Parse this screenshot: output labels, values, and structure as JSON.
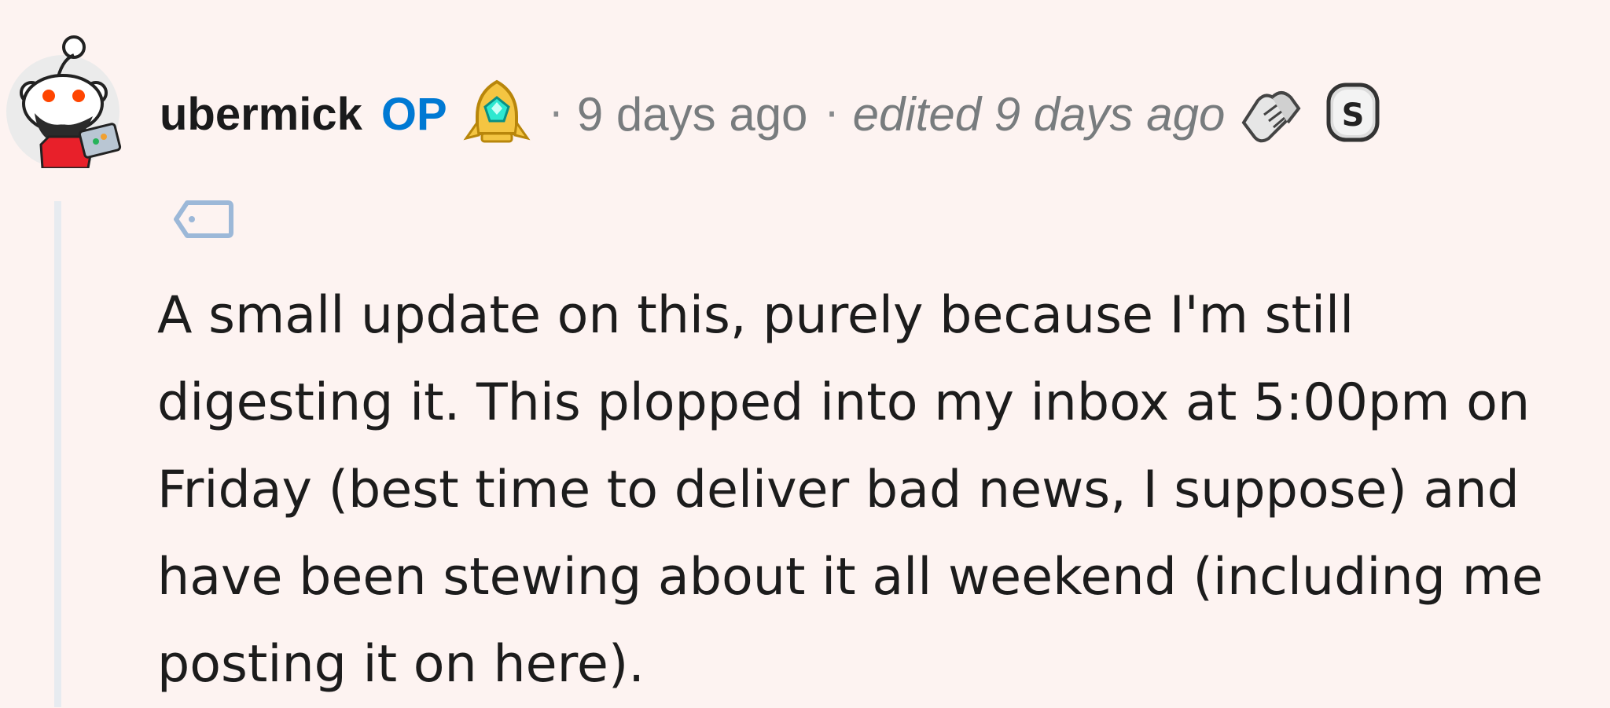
{
  "comment": {
    "author": "ubermick",
    "op_label": "OP",
    "separator": "·",
    "timestamp": "9 days ago",
    "edited": "edited 9 days ago",
    "award_icon": "gem-rocket-award-icon",
    "badges": [
      "handshake-badge-icon",
      "silver-s-badge-icon"
    ],
    "flair_icon": "tag-icon",
    "body": "A small update on this, purely because I'm still digesting it. This plopped into my inbox at 5:00pm on Friday (best time to deliver bad news, I suppose) and have been stewing about it all weekend (including me posting it on here)."
  },
  "colors": {
    "background": "#fdf3f1",
    "op": "#0079d3",
    "meta": "#787c7e",
    "thread_line": "#e7ebf0",
    "avatar_shirt": "#e8202a"
  }
}
